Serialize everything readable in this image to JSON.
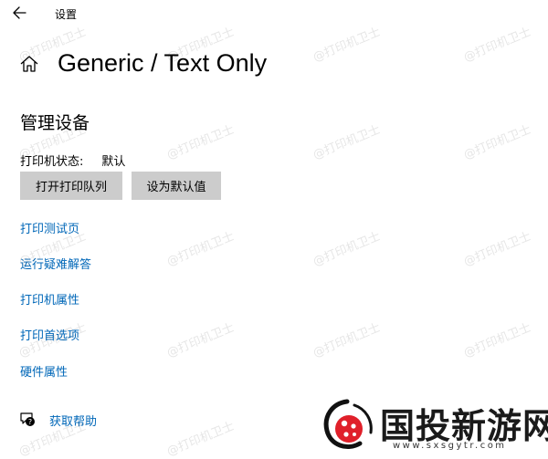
{
  "window": {
    "title": "设置"
  },
  "header": {
    "page_title": "Generic / Text Only"
  },
  "manage": {
    "section_title": "管理设备",
    "status_label": "打印机状态:",
    "status_value": "默认",
    "open_queue_label": "打开打印队列",
    "set_default_label": "设为默认值"
  },
  "links": [
    {
      "label": "打印测试页"
    },
    {
      "label": "运行疑难解答"
    },
    {
      "label": "打印机属性"
    },
    {
      "label": "打印首选项"
    },
    {
      "label": "硬件属性"
    }
  ],
  "help": {
    "label": "获取帮助"
  },
  "watermark": {
    "text": "@打印机卫士"
  },
  "logo": {
    "text": "国投新游网",
    "url": "www.sxsgytr.com"
  },
  "icons": {
    "back": "back-arrow-icon",
    "home": "home-icon",
    "help": "help-chat-icon"
  },
  "colors": {
    "link": "#0067b8",
    "button_bg": "#cccccc",
    "logo_red": "#e0202a"
  }
}
